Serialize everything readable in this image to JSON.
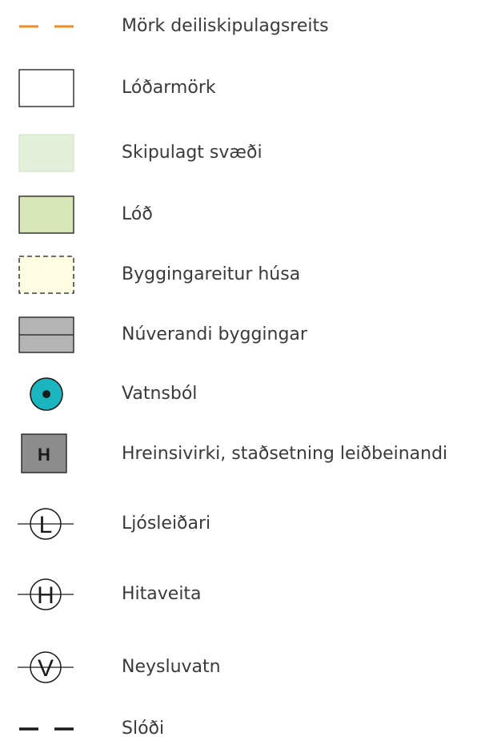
{
  "legend": {
    "items": [
      {
        "label": "Mörk deiliskipulagsreits",
        "icon": "orange-dashed-line-icon"
      },
      {
        "label": "Lóðarmörk",
        "icon": "outlined-rectangle-icon"
      },
      {
        "label": "Skipulagt svæði",
        "icon": "light-green-rectangle-icon"
      },
      {
        "label": "Lóð",
        "icon": "green-rectangle-icon"
      },
      {
        "label": "Byggingareitur húsa",
        "icon": "dashed-yellow-rectangle-icon"
      },
      {
        "label": "Núverandi byggingar",
        "icon": "gray-building-icon"
      },
      {
        "label": "Vatnsból",
        "icon": "cyan-well-circle-icon"
      },
      {
        "label": "Hreinsivirki, staðsetning leiðbeinandi",
        "icon": "gray-h-square-icon",
        "glyph": "H"
      },
      {
        "label": "Ljósleiðari",
        "icon": "line-crossing-circle-l-icon",
        "glyph": "L"
      },
      {
        "label": "Hitaveita",
        "icon": "line-crossing-circle-h-icon",
        "glyph": "H"
      },
      {
        "label": "Neysluvatn",
        "icon": "line-crossing-circle-v-icon",
        "glyph": "V"
      },
      {
        "label": "Slóði",
        "icon": "black-dashed-line-icon"
      }
    ]
  },
  "colors": {
    "text": "#3a3a3a",
    "boundary_orange": "#f08a24",
    "planned_area_fill": "#e3efd9",
    "planned_area_stroke": "#d6e8c6",
    "lot_fill": "#d7e5b8",
    "building_plot_fill": "#fefde2",
    "building_fill": "#b4b4b4",
    "well_fill": "#1bb5c0",
    "treatment_fill": "#8c8c8c",
    "dark": "#1a1a1a"
  }
}
